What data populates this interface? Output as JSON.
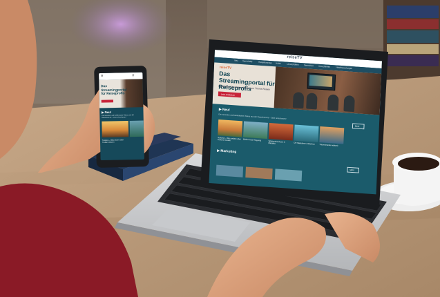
{
  "laptop": {
    "logo": "reiseTV",
    "nav": [
      "Neu",
      "Top-Inhalte",
      "Reisebranchen",
      "Kultur",
      "Landschaften",
      "Fernreisen",
      "Kreuzfahrten",
      "Hotelbewertungen"
    ],
    "hero_logo": "reiseTV",
    "hero_title": "Das Streamingportal für Reiseprofis",
    "hero_subtitle": "Entdecken Sie unsere Videos zum Thema Reisen",
    "hero_button": "Jetzt entdecken",
    "section1_title": "▶ Neu!",
    "section1_sub": "Die neuesten und beliebtesten Videos aus der Reisebranche – Jetzt reinschauen!",
    "more_label": "Mehr",
    "captions": [
      "Toskana – Was andere über Toskana wissen",
      "Sizilien Insel-Hopping",
      "Wüstenabenteuer in Marokko",
      "Die Malediven entdecken",
      "Traumstrände weltweit"
    ],
    "section2_title": "▶ Marketing",
    "more2_label": "Mehr"
  },
  "phone": {
    "menu_icon": "≡",
    "search_icon": "⚲",
    "hero_title": "Das Streamingportal für Reiseprofis",
    "section_title": "▶ Neu!",
    "section_sub": "Die neuesten und beliebtesten Videos aus der Reisebranche – Jetzt reinschauen!",
    "caption": "Toskana – Was andere über Toskana wissen"
  },
  "colors": {
    "site_teal": "#1b5b6b",
    "cta_red": "#c8243a",
    "title_teal": "#0f4352"
  }
}
